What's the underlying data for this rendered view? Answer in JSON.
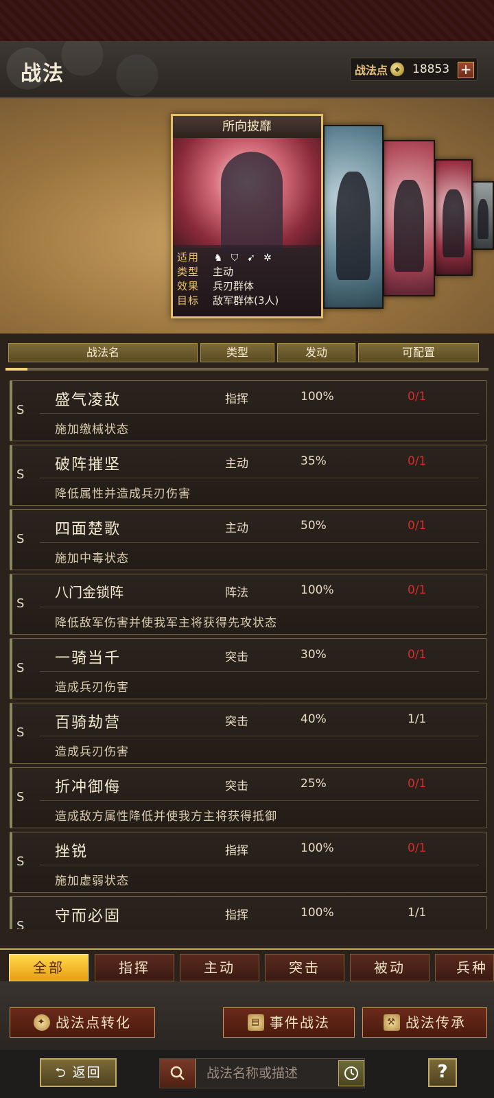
{
  "header": {
    "title": "战法",
    "points_label": "战法点",
    "points_value": "18853",
    "plus_label": "+"
  },
  "featured_card": {
    "name": "所向披靡",
    "rows": [
      {
        "key": "适用",
        "value": ""
      },
      {
        "key": "类型",
        "value": "主动"
      },
      {
        "key": "效果",
        "value": "兵刃群体"
      },
      {
        "key": "目标",
        "value": "敌军群体(3人)"
      }
    ],
    "unit_icons": [
      "cavalry-icon",
      "shield-icon",
      "spear-icon",
      "wheel-icon"
    ]
  },
  "table": {
    "columns": [
      "战法名",
      "类型",
      "发动",
      "可配置"
    ]
  },
  "skills": [
    {
      "grade": "S",
      "name": "盛气凌敌",
      "type": "指挥",
      "rate": "100%",
      "config": "0/1",
      "config_color": "red",
      "desc": "施加缴械状态"
    },
    {
      "grade": "S",
      "name": "破阵摧坚",
      "type": "主动",
      "rate": "35%",
      "config": "0/1",
      "config_color": "red",
      "desc": "降低属性并造成兵刃伤害"
    },
    {
      "grade": "S",
      "name": "四面楚歌",
      "type": "主动",
      "rate": "50%",
      "config": "0/1",
      "config_color": "red",
      "desc": "施加中毒状态"
    },
    {
      "grade": "S",
      "name": "八门金锁阵",
      "type": "阵法",
      "rate": "100%",
      "config": "0/1",
      "config_color": "red",
      "desc": "降低敌军伤害并使我军主将获得先攻状态"
    },
    {
      "grade": "S",
      "name": "一骑当千",
      "type": "突击",
      "rate": "30%",
      "config": "0/1",
      "config_color": "red",
      "desc": "造成兵刃伤害"
    },
    {
      "grade": "S",
      "name": "百骑劫营",
      "type": "突击",
      "rate": "40%",
      "config": "1/1",
      "config_color": "white",
      "desc": "造成兵刃伤害"
    },
    {
      "grade": "S",
      "name": "折冲御侮",
      "type": "突击",
      "rate": "25%",
      "config": "0/1",
      "config_color": "red",
      "desc": "造成敌方属性降低并使我方主将获得抵御"
    },
    {
      "grade": "S",
      "name": "挫锐",
      "type": "指挥",
      "rate": "100%",
      "config": "0/1",
      "config_color": "red",
      "desc": "施加虚弱状态"
    },
    {
      "grade": "S",
      "name": "守而必固",
      "type": "指挥",
      "rate": "100%",
      "config": "1/1",
      "config_color": "white",
      "desc": ""
    }
  ],
  "tabs": [
    "全部",
    "指挥",
    "主动",
    "突击",
    "被动",
    "兵种"
  ],
  "actions": {
    "convert": "战法点转化",
    "event": "事件战法",
    "inherit": "战法传承"
  },
  "footer": {
    "back": "返回",
    "search_placeholder": "战法名称或描述",
    "help": "?"
  }
}
